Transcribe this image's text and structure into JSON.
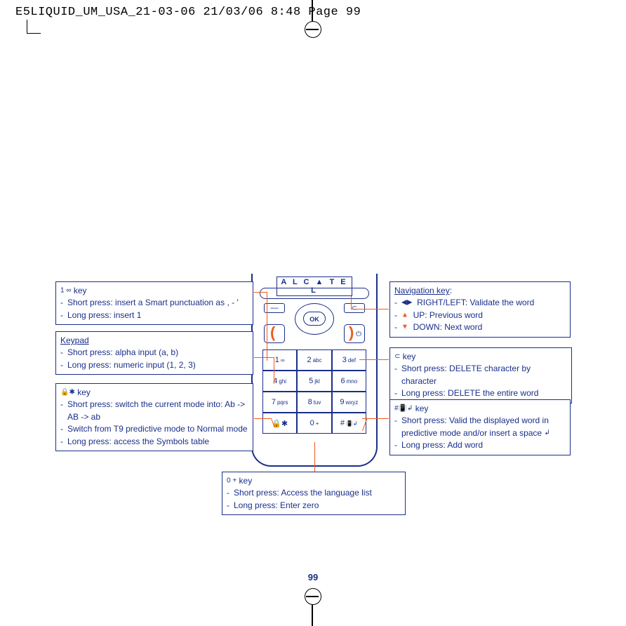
{
  "header": "E5LIQUID_UM_USA_21-03-06  21/03/06  8:48  Page 99",
  "page_number": "99",
  "phone": {
    "brand": "A L C ▲ T E L",
    "ok_label": "OK",
    "keys": [
      {
        "num": "1",
        "lbl": "∞"
      },
      {
        "num": "2",
        "lbl": "abc"
      },
      {
        "num": "3",
        "lbl": "def"
      },
      {
        "num": "4",
        "lbl": "ghi"
      },
      {
        "num": "5",
        "lbl": "jkl"
      },
      {
        "num": "6",
        "lbl": "mno"
      },
      {
        "num": "7",
        "lbl": "pqrs"
      },
      {
        "num": "8",
        "lbl": "tuv"
      },
      {
        "num": "9",
        "lbl": "wxyz"
      },
      {
        "num": "🔒✱",
        "lbl": ""
      },
      {
        "num": "0",
        "lbl": "+"
      },
      {
        "num": "#",
        "lbl": "📳↲"
      }
    ]
  },
  "callouts": {
    "key1": {
      "title_icon": "1 ∞",
      "title": "key",
      "line1": "Short press: insert a Smart punctuation as , - '",
      "line2": "Long press: insert 1"
    },
    "keypad": {
      "title": "Keypad",
      "line1": "Short press: alpha input (a, b)",
      "line2": "Long press: numeric input (1, 2, 3)"
    },
    "star": {
      "title_icon": "🔒✱",
      "title": "key",
      "line1": "Short press: switch the current mode into: Ab -> AB -> ab",
      "line2": "Switch from T9 predictive mode to Normal mode",
      "line3": "Long press: access the Symbols table"
    },
    "nav": {
      "title": "Navigation key",
      "line1_icon": "◀▶",
      "line1": "RIGHT/LEFT: Validate the word",
      "line2_icon": "▲",
      "line2": "UP: Previous word",
      "line3_icon": "▼",
      "line3": "DOWN: Next word"
    },
    "ckey": {
      "title_icon": "⊂",
      "title": "key",
      "line1": "Short press: DELETE character by character",
      "line2": "Long press: DELETE the entire word"
    },
    "hash": {
      "title_icon": "#📳↲",
      "title": "key",
      "line1a": "Short press: Valid the displayed word in predictive mode and/or insert a space",
      "line1_endicon": "↲",
      "line2": "Long press: Add word"
    },
    "zero": {
      "title_icon": "0 +",
      "title": "key",
      "line1": "Short press: Access the language list",
      "line2": "Long press: Enter zero"
    }
  }
}
